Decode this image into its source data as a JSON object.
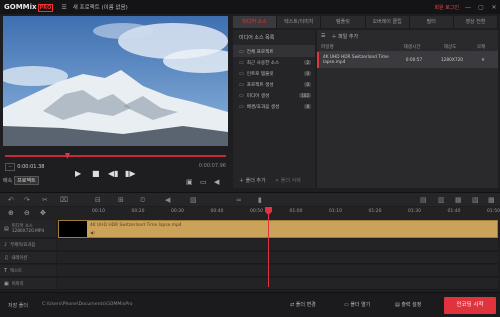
{
  "titlebar": {
    "logo": "GOM",
    "logo_mix": "Mix",
    "logo_pro": "PRO",
    "project_title": "새 프로젝트 (이름 없음)",
    "login": "회원 로그인",
    "min": "—",
    "max": "▢",
    "close": "✕"
  },
  "player": {
    "time_start": "0:00:01.38",
    "time_current": "0:00:07.96",
    "speed_label": "배속",
    "speed_value": "프로젝트",
    "progress_fraction": 0.28
  },
  "tabs": [
    "미디어 소스",
    "텍스트/이미지",
    "템플릿",
    "오버레이 클립",
    "필터",
    "영상 전환"
  ],
  "active_tab": 0,
  "sources": {
    "header": "미디어 소스 목록",
    "items": [
      {
        "label": "전체 프로젝트",
        "count": ""
      },
      {
        "label": "최근 사용한 소스",
        "count": "2"
      },
      {
        "label": "인트로 템플릿",
        "count": "0"
      },
      {
        "label": "프로젝트 생성",
        "count": "0"
      },
      {
        "label": "미디어 생성",
        "count": "102"
      },
      {
        "label": "배경/효과음 생성",
        "count": "8"
      }
    ],
    "add_folder": "폴더 추가",
    "delete_folder": "폴더 삭제"
  },
  "files": {
    "add_file": "파일 추가",
    "columns": [
      "파일명",
      "재생시간",
      "해상도",
      "삭제"
    ],
    "rows": [
      {
        "name": "4K UHD HDR Switzerland Time lapse.mp4",
        "length": "0:00:57",
        "resolution": "1280X720",
        "delete": "✕"
      }
    ]
  },
  "timeline": {
    "ticks": [
      "00:10",
      "00:20",
      "00:30",
      "00:40",
      "00:50",
      "01:00",
      "01:10",
      "01:20",
      "01:30",
      "01:40",
      "01:50"
    ],
    "tracks": [
      {
        "icon": "film-icon",
        "label": "미디어 소스\n1280X720.MP4"
      },
      {
        "icon": "music-icon",
        "label": "부제목/효과음"
      },
      {
        "icon": "mic-icon",
        "label": "내레이션"
      },
      {
        "icon": "text-icon",
        "label": "텍스트"
      },
      {
        "icon": "image-icon",
        "label": "이미지"
      }
    ],
    "clip_name": "4K UHD HDR Switzerland Time lapse.mp4",
    "clip_volume": "◀)"
  },
  "bottombar": {
    "save_label": "저장 폴더",
    "save_path": "C:\\Users\\Phone\\Documents\\GOMMixPro",
    "change_folder": "폴더 변경",
    "open_folder": "폴더 열기",
    "output_settings": "출력 설정",
    "encode": "인코딩 시작"
  }
}
